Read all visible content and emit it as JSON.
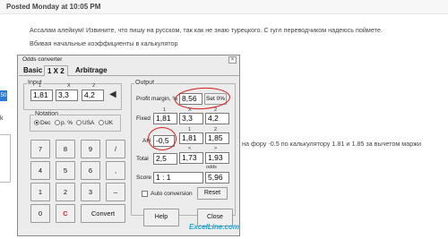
{
  "post": {
    "posted": "Posted Monday at 10:05 PM",
    "line1": "Ассалам алейкум! Извините, что пишу на русском, так как не знаю турецкого. С гугл переводчиком надеюсь поймете.",
    "line2": "Вбивая  начальные коэффициенты в калькулятор",
    "line3": "на фору -0.5 по калькулятору 1.81 и 1.85 за вычетом маржи"
  },
  "left_strip": {
    "badge": "50",
    "letter": "k"
  },
  "window": {
    "title": "Odds converter",
    "close": "×",
    "tabs": [
      "Basic",
      "1 X 2",
      "Arbitrage"
    ],
    "input": {
      "label": "Input",
      "col_headers": [
        "1",
        "X",
        "2"
      ],
      "values": [
        "1,81",
        "3,3",
        "4,2"
      ],
      "arrow": "◀"
    },
    "notation": {
      "label": "Notation",
      "options": [
        "Dec",
        "p. %",
        "USA",
        "UK"
      ],
      "selected": "Dec"
    },
    "keypad": {
      "rows": [
        [
          "7",
          "8",
          "9",
          "/"
        ],
        [
          "4",
          "5",
          "6",
          ","
        ],
        [
          "1",
          "2",
          "3",
          "–"
        ]
      ],
      "zero": "0",
      "clear": "C",
      "convert": "Convert"
    },
    "output": {
      "label": "Output",
      "profit_margin_label": "Profit margin, %",
      "profit_margin": "8,56",
      "set0_label": "Set 0%",
      "fixed_headers": [
        "1",
        "X",
        "2"
      ],
      "fixed_label": "Fixed",
      "fixed": [
        "1,81",
        "3,3",
        "4,2"
      ],
      "ah_headers": [
        "1",
        "2"
      ],
      "ah_label": "AH",
      "ah": [
        "-0,5",
        "1,81",
        "1,85"
      ],
      "total_headers": [
        "<",
        ">"
      ],
      "total_label": "Total",
      "total": [
        "2,5",
        "1,73",
        "1,93"
      ],
      "odds_header": "odds",
      "score_label": "Score",
      "score": "1 : 1",
      "score_odds": "5,96",
      "auto_conversion": "Auto conversion",
      "reset": "Reset"
    },
    "help": "Help",
    "close_button": "Close"
  },
  "watermark": "ExcelLine.com"
}
